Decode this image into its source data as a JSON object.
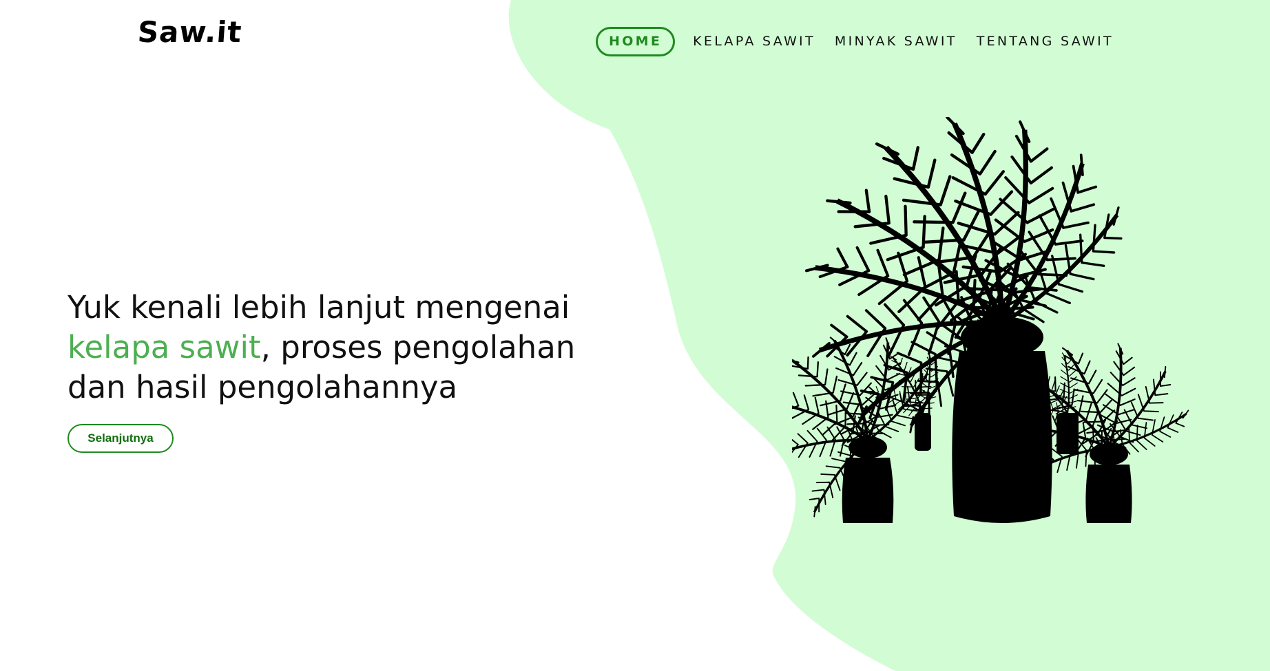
{
  "brand": {
    "logo_text": "Saw.it"
  },
  "nav": {
    "items": [
      {
        "label": "HOME",
        "active": true
      },
      {
        "label": "KELAPA SAWIT",
        "active": false
      },
      {
        "label": "MINYAK SAWIT",
        "active": false
      },
      {
        "label": "TENTANG SAWIT",
        "active": false
      }
    ]
  },
  "hero": {
    "line1": "Yuk kenali lebih lanjut mengenai",
    "highlight": "kelapa sawit",
    "line2_rest": ", proses pengolahan",
    "line3": "dan hasil pengolahannya",
    "button_label": "Selanjutnya"
  },
  "illustration": {
    "icon": "palm-trees-silhouette-icon"
  },
  "colors": {
    "accent": "#1f8a1f",
    "highlight_text": "#4caf50",
    "blob_background": "#d2fdd4",
    "text": "#111111"
  }
}
